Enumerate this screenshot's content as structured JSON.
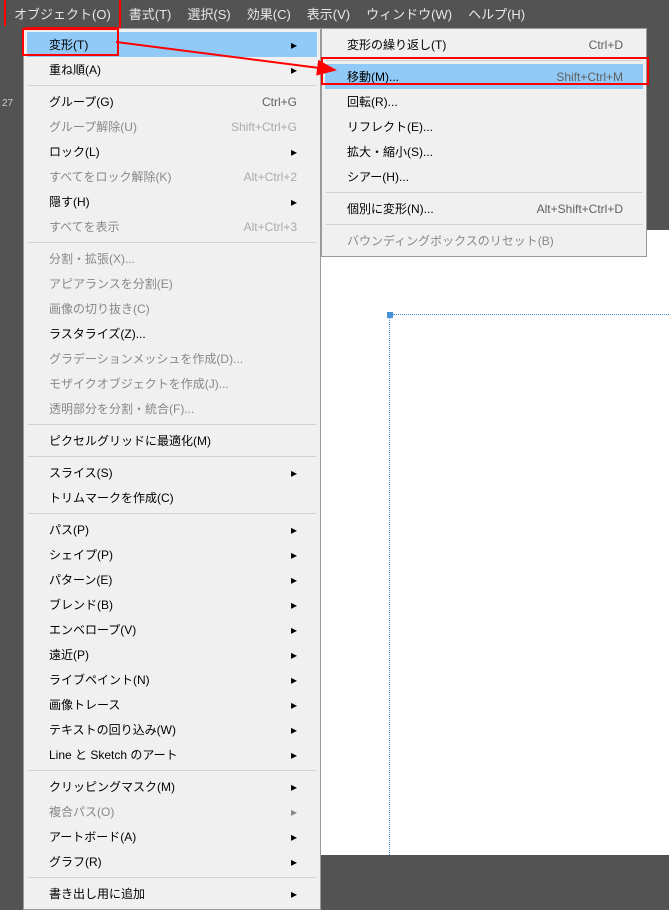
{
  "menubar": {
    "items": [
      {
        "label": "オブジェクト(O)",
        "active": true
      },
      {
        "label": "書式(T)"
      },
      {
        "label": "選択(S)"
      },
      {
        "label": "効果(C)"
      },
      {
        "label": "表示(V)"
      },
      {
        "label": "ウィンドウ(W)"
      },
      {
        "label": "ヘルプ(H)"
      }
    ]
  },
  "mainMenu": {
    "items": [
      {
        "label": "変形(T)",
        "submenu": true,
        "selected": true
      },
      {
        "label": "重ね順(A)",
        "submenu": true
      },
      {
        "divider": true
      },
      {
        "label": "グループ(G)",
        "shortcut": "Ctrl+G"
      },
      {
        "label": "グループ解除(U)",
        "shortcut": "Shift+Ctrl+G",
        "disabled": true
      },
      {
        "label": "ロック(L)",
        "submenu": true
      },
      {
        "label": "すべてをロック解除(K)",
        "shortcut": "Alt+Ctrl+2",
        "disabled": true
      },
      {
        "label": "隠す(H)",
        "submenu": true
      },
      {
        "label": "すべてを表示",
        "shortcut": "Alt+Ctrl+3",
        "disabled": true
      },
      {
        "divider": true
      },
      {
        "label": "分割・拡張(X)...",
        "disabled": true
      },
      {
        "label": "アピアランスを分割(E)",
        "disabled": true
      },
      {
        "label": "画像の切り抜き(C)",
        "disabled": true
      },
      {
        "label": "ラスタライズ(Z)..."
      },
      {
        "label": "グラデーションメッシュを作成(D)...",
        "disabled": true
      },
      {
        "label": "モザイクオブジェクトを作成(J)...",
        "disabled": true
      },
      {
        "label": "透明部分を分割・統合(F)...",
        "disabled": true
      },
      {
        "divider": true
      },
      {
        "label": "ピクセルグリッドに最適化(M)"
      },
      {
        "divider": true
      },
      {
        "label": "スライス(S)",
        "submenu": true
      },
      {
        "label": "トリムマークを作成(C)"
      },
      {
        "divider": true
      },
      {
        "label": "パス(P)",
        "submenu": true
      },
      {
        "label": "シェイプ(P)",
        "submenu": true
      },
      {
        "label": "パターン(E)",
        "submenu": true
      },
      {
        "label": "ブレンド(B)",
        "submenu": true
      },
      {
        "label": "エンベロープ(V)",
        "submenu": true
      },
      {
        "label": "遠近(P)",
        "submenu": true
      },
      {
        "label": "ライブペイント(N)",
        "submenu": true
      },
      {
        "label": "画像トレース",
        "submenu": true
      },
      {
        "label": "テキストの回り込み(W)",
        "submenu": true
      },
      {
        "label": "Line と Sketch のアート",
        "submenu": true
      },
      {
        "divider": true
      },
      {
        "label": "クリッピングマスク(M)",
        "submenu": true
      },
      {
        "label": "複合パス(O)",
        "submenu": true,
        "disabled": true
      },
      {
        "label": "アートボード(A)",
        "submenu": true
      },
      {
        "label": "グラフ(R)",
        "submenu": true
      },
      {
        "divider": true
      },
      {
        "label": "書き出し用に追加",
        "submenu": true
      }
    ]
  },
  "submenu": {
    "items": [
      {
        "label": "変形の繰り返し(T)",
        "shortcut": "Ctrl+D"
      },
      {
        "divider": true
      },
      {
        "label": "移動(M)...",
        "shortcut": "Shift+Ctrl+M",
        "selected": true
      },
      {
        "label": "回転(R)..."
      },
      {
        "label": "リフレクト(E)..."
      },
      {
        "label": "拡大・縮小(S)..."
      },
      {
        "label": "シアー(H)..."
      },
      {
        "divider": true
      },
      {
        "label": "個別に変形(N)...",
        "shortcut": "Alt+Shift+Ctrl+D"
      },
      {
        "divider": true
      },
      {
        "label": "バウンディングボックスのリセット(B)",
        "disabled": true
      }
    ]
  },
  "leftLabel": "27"
}
